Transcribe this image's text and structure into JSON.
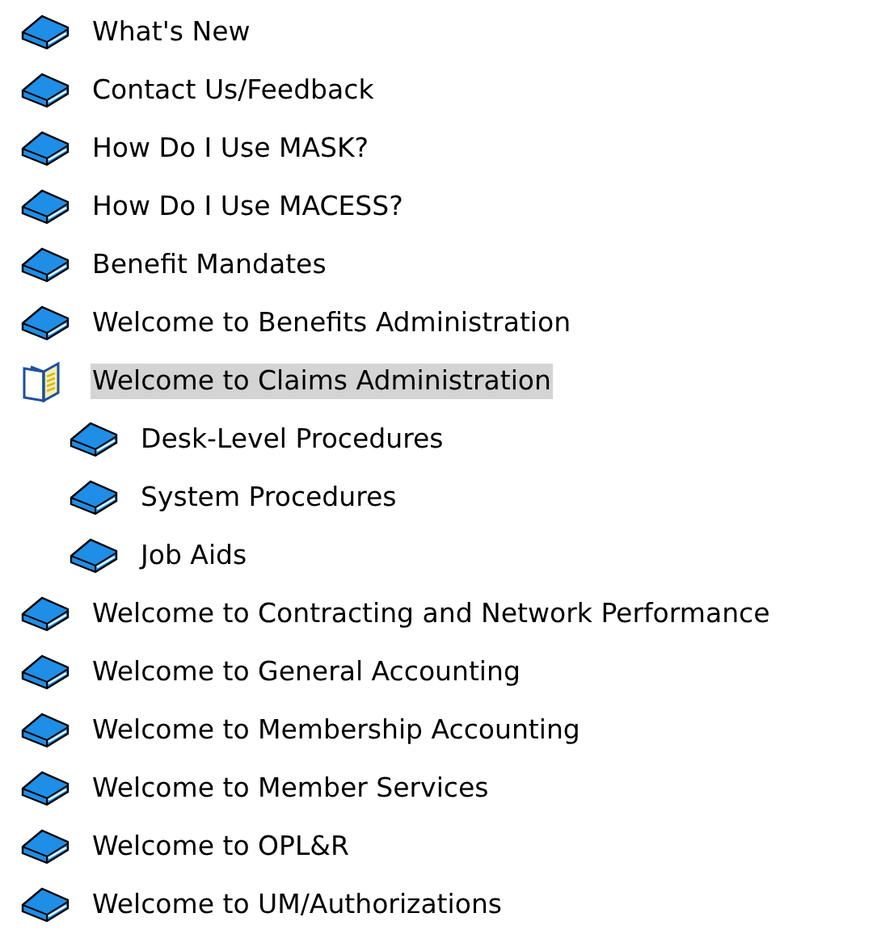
{
  "tree": [
    {
      "label": "What's New",
      "expanded": false,
      "selected": false
    },
    {
      "label": "Contact Us/Feedback",
      "expanded": false,
      "selected": false
    },
    {
      "label": "How Do I Use MASK?",
      "expanded": false,
      "selected": false
    },
    {
      "label": "How Do I Use MACESS?",
      "expanded": false,
      "selected": false
    },
    {
      "label": "Benefit Mandates",
      "expanded": false,
      "selected": false
    },
    {
      "label": "Welcome to Benefits Administration",
      "expanded": false,
      "selected": false
    },
    {
      "label": "Welcome to Claims Administration",
      "expanded": true,
      "selected": true,
      "children": [
        {
          "label": "Desk-Level Procedures",
          "expanded": false,
          "selected": false
        },
        {
          "label": "System Procedures",
          "expanded": false,
          "selected": false
        },
        {
          "label": "Job Aids",
          "expanded": false,
          "selected": false
        }
      ]
    },
    {
      "label": "Welcome to Contracting and Network Performance",
      "expanded": false,
      "selected": false
    },
    {
      "label": "Welcome to General Accounting",
      "expanded": false,
      "selected": false
    },
    {
      "label": "Welcome to Membership Accounting",
      "expanded": false,
      "selected": false
    },
    {
      "label": "Welcome to Member Services",
      "expanded": false,
      "selected": false
    },
    {
      "label": "Welcome to OPL&R",
      "expanded": false,
      "selected": false
    },
    {
      "label": "Welcome to UM/Authorizations",
      "expanded": false,
      "selected": false
    }
  ]
}
